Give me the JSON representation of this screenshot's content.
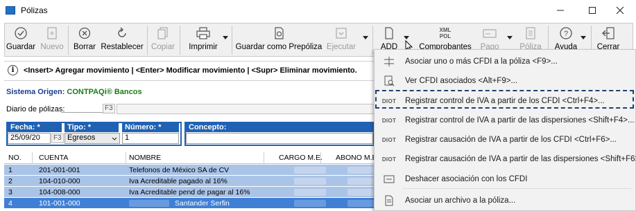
{
  "window": {
    "title": "Pólizas"
  },
  "toolbar": {
    "guardar": "Guardar",
    "nuevo": "Nuevo",
    "borrar": "Borrar",
    "restablecer": "Restablecer",
    "copiar": "Copiar",
    "imprimir": "Imprimir",
    "guardar_prepoliza": "Guardar como Prepóliza",
    "ejecutar": "Ejecutar",
    "add": "ADD",
    "comprobantes": "Comprobantes",
    "xml": "XML",
    "pol": "POL",
    "pago": "Pago",
    "poliza": "Póliza",
    "ayuda": "Ayuda",
    "cerrar": "Cerrar"
  },
  "info": {
    "message": "<Insert> Agregar movimiento | <Enter> Modificar movimiento | <Supr> Eliminar movimiento."
  },
  "origin": {
    "label": "Sistema Origen:",
    "value": "CONTPAQi® Bancos"
  },
  "diario": {
    "label": "Diario de pólizas:",
    "f3": "F3"
  },
  "form": {
    "fecha_label": "Fecha: *",
    "fecha_value": "25/09/20",
    "fecha_f3": "F3",
    "tipo_label": "Tipo: *",
    "tipo_value": "Egresos",
    "numero_label": "Número: *",
    "numero_value": "1",
    "concepto_label": "Concepto:"
  },
  "grid": {
    "columns": [
      "NO.",
      "CUENTA",
      "NOMBRE",
      "CARGO M.E.",
      "ABONO M.E."
    ],
    "rows": [
      {
        "no": "1",
        "cuenta": "201-001-001",
        "nombre": "Telefonos de México SA de CV"
      },
      {
        "no": "2",
        "cuenta": "104-010-000",
        "nombre": "Iva Acreditable pagado al 16%"
      },
      {
        "no": "3",
        "cuenta": "104-008-000",
        "nombre": "Iva Acreditable pend de pagar al 16%"
      },
      {
        "no": "4",
        "cuenta": "101-001-000",
        "nombre": "Santander Serfin"
      }
    ]
  },
  "menu": {
    "items": [
      {
        "icon": "link-cfdi-icon",
        "label": "Asociar uno o más CFDI a la póliza <F9>..."
      },
      {
        "icon": "view-cfdi-icon",
        "label": "Ver CFDI asociados <Alt+F9>..."
      },
      {
        "icon": "DIOT",
        "label": "Registrar control de IVA a partir de los CFDI <Ctrl+F4>..."
      },
      {
        "icon": "DIOT",
        "label": "Registrar control de IVA a partir de las dispersiones <Shift+F4>..."
      },
      {
        "icon": "DIOT",
        "label": "Registrar causación de IVA a partir de los CFDI <Ctrl+F6>..."
      },
      {
        "icon": "DIOT",
        "label": "Registrar causación de IVA a partir de las dispersiones <Shift+F6>..."
      },
      {
        "icon": "unlink-cfdi-icon",
        "label": "Deshacer asociación con los CFDI"
      },
      {
        "icon": "attach-file-icon",
        "label": "Asociar un archivo a la póliza..."
      }
    ]
  },
  "colors": {
    "accent": "#1f62b3",
    "row_selected": "#aac4e8",
    "row_active": "#3f80d6",
    "origin_value": "#1a7a1a",
    "highlight_frame": "#1f3f6c"
  }
}
